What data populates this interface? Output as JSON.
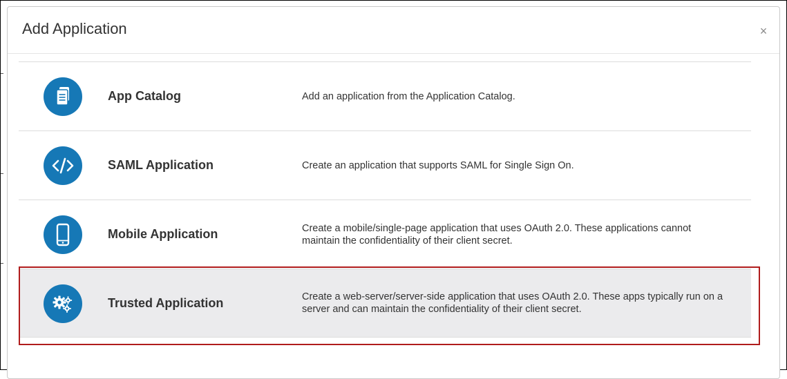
{
  "dialog": {
    "title": "Add Application",
    "close_glyph": "×"
  },
  "options": [
    {
      "name": "App Catalog",
      "description": "Add an application from the Application Catalog.",
      "icon": "document-icon"
    },
    {
      "name": "SAML Application",
      "description": "Create an application that supports SAML for Single Sign On.",
      "icon": "code-icon"
    },
    {
      "name": "Mobile Application",
      "description": "Create a mobile/single-page application that uses OAuth 2.0. These applications cannot maintain the confidentiality of their client secret.",
      "icon": "mobile-phone-icon"
    },
    {
      "name": "Trusted Application",
      "description": "Create a web-server/server-side application that uses OAuth 2.0. These apps typically run on a server and can maintain the confidentiality of their client secret.",
      "icon": "gears-icon",
      "selected": true
    }
  ],
  "colors": {
    "icon_background": "#1678b6",
    "highlight_border": "#b01c1c",
    "selected_row_background": "#ebebed"
  }
}
